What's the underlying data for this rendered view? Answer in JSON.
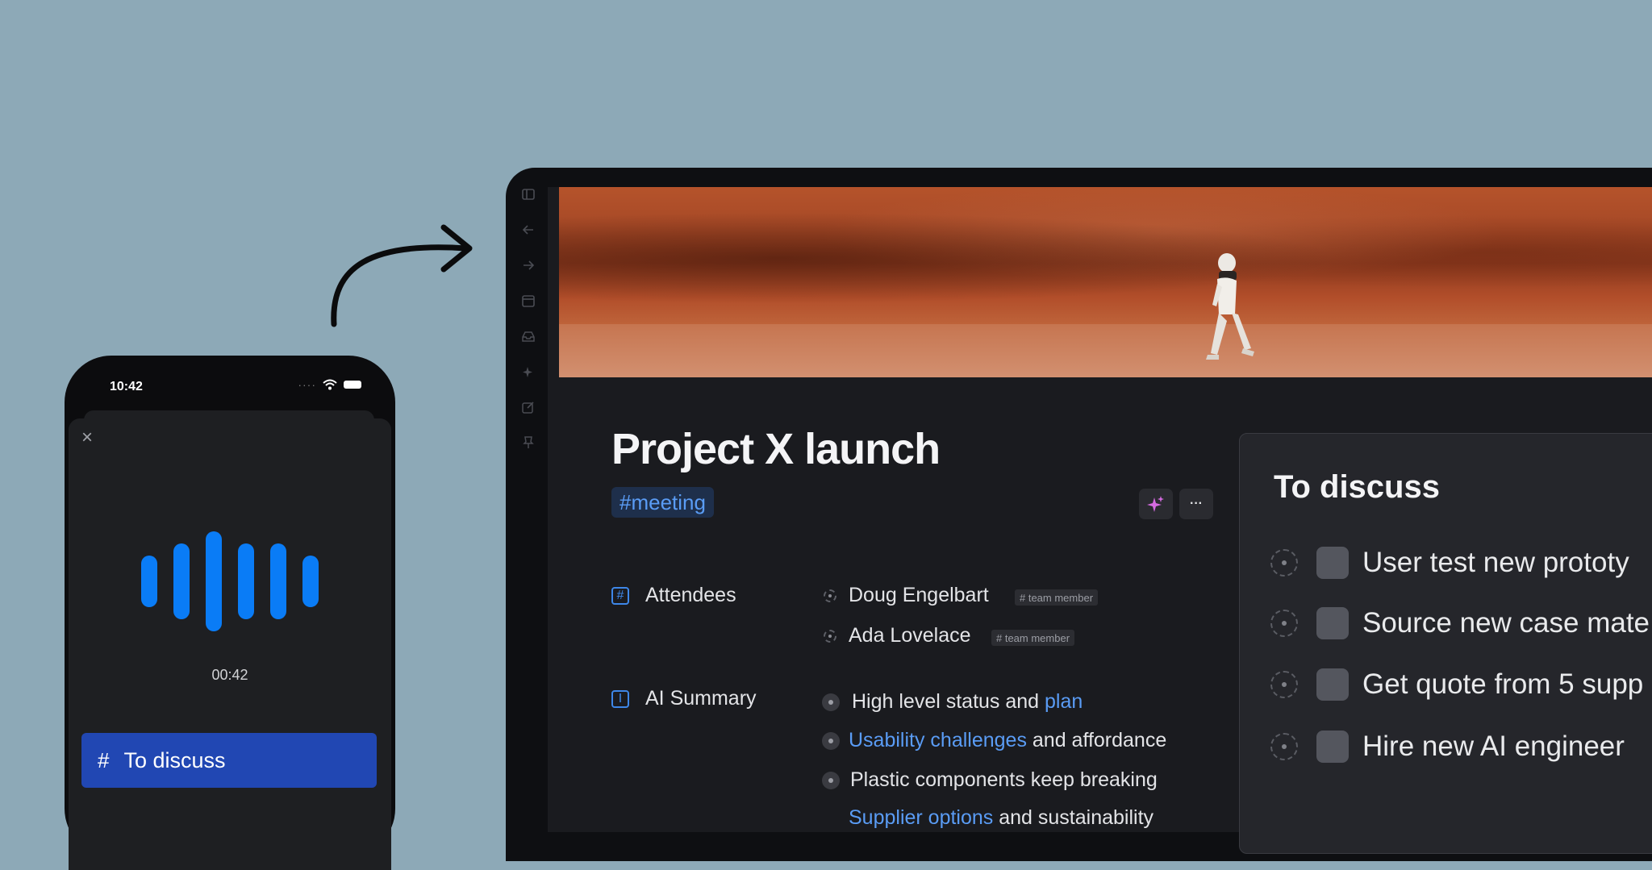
{
  "phone": {
    "time": "10:42",
    "timer": "00:42",
    "close_icon": "×",
    "tag_button": {
      "hash": "#",
      "label": "To discuss"
    }
  },
  "document": {
    "title": "Project X launch",
    "tag": "#meeting",
    "more_label": "···",
    "fields": {
      "attendees": {
        "label": "Attendees",
        "items": [
          {
            "name": "Doug Engelbart",
            "tag": "# team member"
          },
          {
            "name": "Ada Lovelace",
            "tag": "# team member"
          }
        ]
      },
      "ai_summary": {
        "label": "AI Summary",
        "items": [
          {
            "pre": "High level status and ",
            "link": "plan",
            "post": ""
          },
          {
            "pre": "",
            "link": "Usability challenges",
            "post": " and affordance"
          },
          {
            "pre": "Plastic components keep breaking",
            "link": "",
            "post": ""
          },
          {
            "pre": "",
            "link": "Supplier options",
            "post": " and sustainability"
          }
        ]
      }
    }
  },
  "panel": {
    "title": "To discuss",
    "tasks": [
      "User test new prototy",
      "Source new case mate",
      "Get quote from 5 supp",
      "Hire new AI engineer"
    ]
  },
  "colors": {
    "background": "#8DA9B7",
    "accent_blue": "#0A7CF6",
    "tag_blue": "#5A9CF5",
    "button_blue": "#2147B3",
    "sparkle": "#D46BE0"
  },
  "icons": {
    "sidebar": [
      "sidebar-toggle-icon",
      "back-arrow-icon",
      "forward-arrow-icon",
      "calendar-icon",
      "inbox-icon",
      "sparkle-icon",
      "edit-icon",
      "pin-icon"
    ]
  }
}
